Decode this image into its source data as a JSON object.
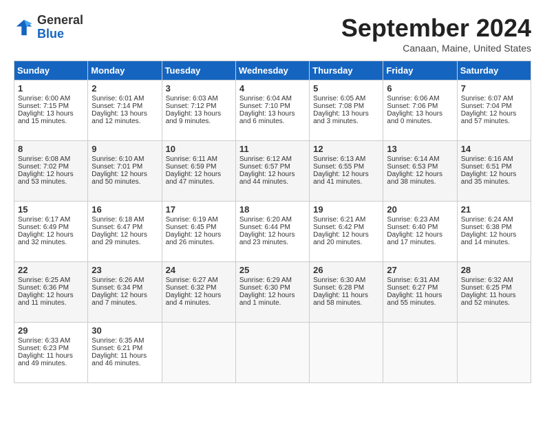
{
  "header": {
    "logo_general": "General",
    "logo_blue": "Blue",
    "month_title": "September 2024",
    "location": "Canaan, Maine, United States"
  },
  "weekdays": [
    "Sunday",
    "Monday",
    "Tuesday",
    "Wednesday",
    "Thursday",
    "Friday",
    "Saturday"
  ],
  "weeks": [
    [
      {
        "day": "1",
        "sunrise": "Sunrise: 6:00 AM",
        "sunset": "Sunset: 7:15 PM",
        "daylight": "Daylight: 13 hours and 15 minutes."
      },
      {
        "day": "2",
        "sunrise": "Sunrise: 6:01 AM",
        "sunset": "Sunset: 7:14 PM",
        "daylight": "Daylight: 13 hours and 12 minutes."
      },
      {
        "day": "3",
        "sunrise": "Sunrise: 6:03 AM",
        "sunset": "Sunset: 7:12 PM",
        "daylight": "Daylight: 13 hours and 9 minutes."
      },
      {
        "day": "4",
        "sunrise": "Sunrise: 6:04 AM",
        "sunset": "Sunset: 7:10 PM",
        "daylight": "Daylight: 13 hours and 6 minutes."
      },
      {
        "day": "5",
        "sunrise": "Sunrise: 6:05 AM",
        "sunset": "Sunset: 7:08 PM",
        "daylight": "Daylight: 13 hours and 3 minutes."
      },
      {
        "day": "6",
        "sunrise": "Sunrise: 6:06 AM",
        "sunset": "Sunset: 7:06 PM",
        "daylight": "Daylight: 13 hours and 0 minutes."
      },
      {
        "day": "7",
        "sunrise": "Sunrise: 6:07 AM",
        "sunset": "Sunset: 7:04 PM",
        "daylight": "Daylight: 12 hours and 57 minutes."
      }
    ],
    [
      {
        "day": "8",
        "sunrise": "Sunrise: 6:08 AM",
        "sunset": "Sunset: 7:02 PM",
        "daylight": "Daylight: 12 hours and 53 minutes."
      },
      {
        "day": "9",
        "sunrise": "Sunrise: 6:10 AM",
        "sunset": "Sunset: 7:01 PM",
        "daylight": "Daylight: 12 hours and 50 minutes."
      },
      {
        "day": "10",
        "sunrise": "Sunrise: 6:11 AM",
        "sunset": "Sunset: 6:59 PM",
        "daylight": "Daylight: 12 hours and 47 minutes."
      },
      {
        "day": "11",
        "sunrise": "Sunrise: 6:12 AM",
        "sunset": "Sunset: 6:57 PM",
        "daylight": "Daylight: 12 hours and 44 minutes."
      },
      {
        "day": "12",
        "sunrise": "Sunrise: 6:13 AM",
        "sunset": "Sunset: 6:55 PM",
        "daylight": "Daylight: 12 hours and 41 minutes."
      },
      {
        "day": "13",
        "sunrise": "Sunrise: 6:14 AM",
        "sunset": "Sunset: 6:53 PM",
        "daylight": "Daylight: 12 hours and 38 minutes."
      },
      {
        "day": "14",
        "sunrise": "Sunrise: 6:16 AM",
        "sunset": "Sunset: 6:51 PM",
        "daylight": "Daylight: 12 hours and 35 minutes."
      }
    ],
    [
      {
        "day": "15",
        "sunrise": "Sunrise: 6:17 AM",
        "sunset": "Sunset: 6:49 PM",
        "daylight": "Daylight: 12 hours and 32 minutes."
      },
      {
        "day": "16",
        "sunrise": "Sunrise: 6:18 AM",
        "sunset": "Sunset: 6:47 PM",
        "daylight": "Daylight: 12 hours and 29 minutes."
      },
      {
        "day": "17",
        "sunrise": "Sunrise: 6:19 AM",
        "sunset": "Sunset: 6:45 PM",
        "daylight": "Daylight: 12 hours and 26 minutes."
      },
      {
        "day": "18",
        "sunrise": "Sunrise: 6:20 AM",
        "sunset": "Sunset: 6:44 PM",
        "daylight": "Daylight: 12 hours and 23 minutes."
      },
      {
        "day": "19",
        "sunrise": "Sunrise: 6:21 AM",
        "sunset": "Sunset: 6:42 PM",
        "daylight": "Daylight: 12 hours and 20 minutes."
      },
      {
        "day": "20",
        "sunrise": "Sunrise: 6:23 AM",
        "sunset": "Sunset: 6:40 PM",
        "daylight": "Daylight: 12 hours and 17 minutes."
      },
      {
        "day": "21",
        "sunrise": "Sunrise: 6:24 AM",
        "sunset": "Sunset: 6:38 PM",
        "daylight": "Daylight: 12 hours and 14 minutes."
      }
    ],
    [
      {
        "day": "22",
        "sunrise": "Sunrise: 6:25 AM",
        "sunset": "Sunset: 6:36 PM",
        "daylight": "Daylight: 12 hours and 11 minutes."
      },
      {
        "day": "23",
        "sunrise": "Sunrise: 6:26 AM",
        "sunset": "Sunset: 6:34 PM",
        "daylight": "Daylight: 12 hours and 7 minutes."
      },
      {
        "day": "24",
        "sunrise": "Sunrise: 6:27 AM",
        "sunset": "Sunset: 6:32 PM",
        "daylight": "Daylight: 12 hours and 4 minutes."
      },
      {
        "day": "25",
        "sunrise": "Sunrise: 6:29 AM",
        "sunset": "Sunset: 6:30 PM",
        "daylight": "Daylight: 12 hours and 1 minute."
      },
      {
        "day": "26",
        "sunrise": "Sunrise: 6:30 AM",
        "sunset": "Sunset: 6:28 PM",
        "daylight": "Daylight: 11 hours and 58 minutes."
      },
      {
        "day": "27",
        "sunrise": "Sunrise: 6:31 AM",
        "sunset": "Sunset: 6:27 PM",
        "daylight": "Daylight: 11 hours and 55 minutes."
      },
      {
        "day": "28",
        "sunrise": "Sunrise: 6:32 AM",
        "sunset": "Sunset: 6:25 PM",
        "daylight": "Daylight: 11 hours and 52 minutes."
      }
    ],
    [
      {
        "day": "29",
        "sunrise": "Sunrise: 6:33 AM",
        "sunset": "Sunset: 6:23 PM",
        "daylight": "Daylight: 11 hours and 49 minutes."
      },
      {
        "day": "30",
        "sunrise": "Sunrise: 6:35 AM",
        "sunset": "Sunset: 6:21 PM",
        "daylight": "Daylight: 11 hours and 46 minutes."
      },
      null,
      null,
      null,
      null,
      null
    ]
  ]
}
